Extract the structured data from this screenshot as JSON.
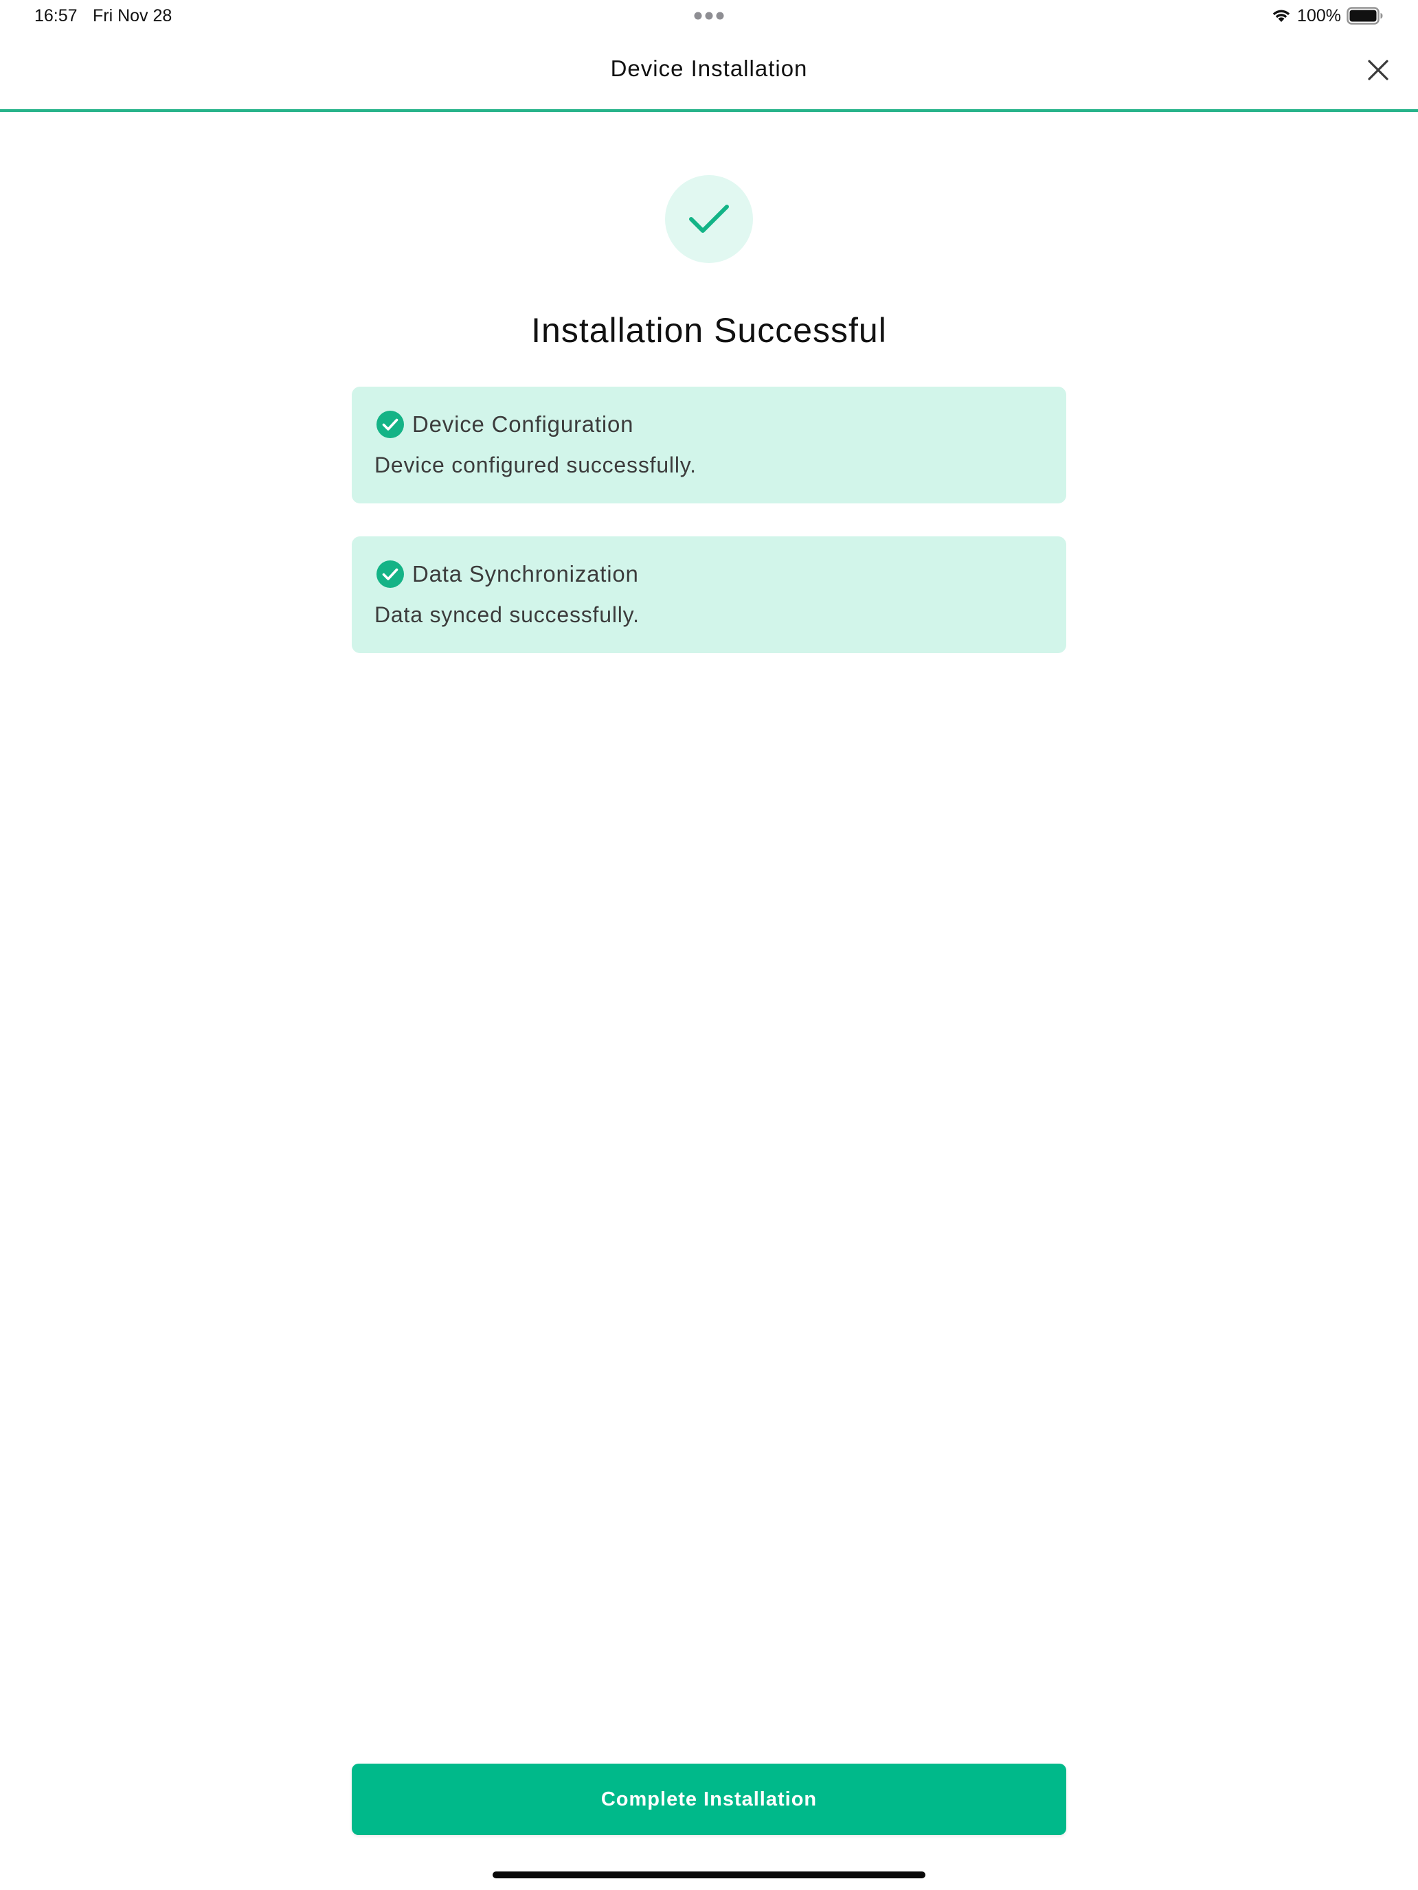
{
  "status_bar": {
    "time": "16:57",
    "date": "Fri Nov 28",
    "battery_percent": "100%",
    "wifi_icon": "wifi-icon",
    "battery_icon": "battery-full-icon",
    "multitask_icon": "ellipsis-icon"
  },
  "header": {
    "title": "Device Installation",
    "close_icon": "close-icon"
  },
  "success": {
    "icon": "checkmark-icon",
    "title": "Installation Successful"
  },
  "cards": [
    {
      "icon": "check-circle-icon",
      "title": "Device Configuration",
      "description": "Device configured successfully."
    },
    {
      "icon": "check-circle-icon",
      "title": "Data Synchronization",
      "description": "Data synced successfully."
    }
  ],
  "actions": {
    "complete_label": "Complete Installation"
  },
  "colors": {
    "accent": "#00b98a",
    "divider": "#27b38a",
    "card_background": "#d2f5ea",
    "icon_circle_background": "#e1f8f1"
  }
}
